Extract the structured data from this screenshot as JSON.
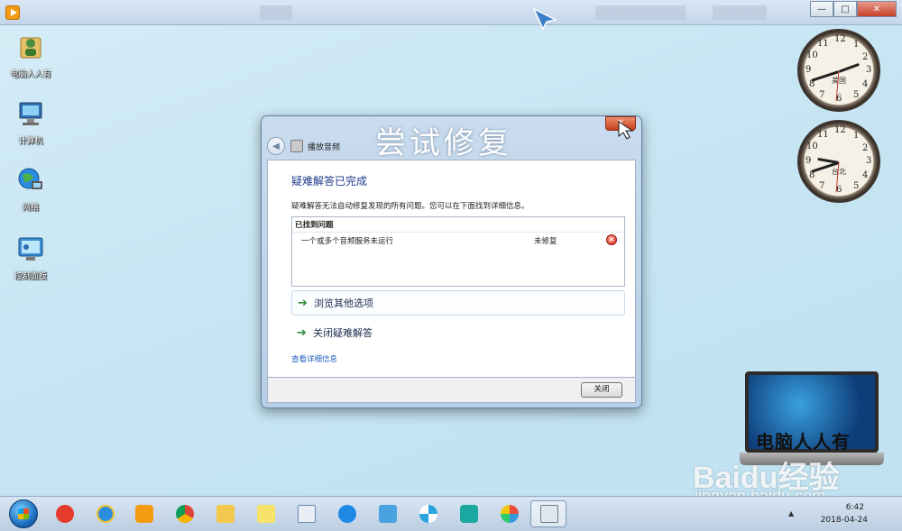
{
  "window": {
    "icon": "media-player-icon",
    "controls": {
      "minimize": "—",
      "maximize": "□",
      "close": "✕"
    }
  },
  "desktop_icons": [
    {
      "label": "电脑人人有",
      "icon": "user-folder-icon"
    },
    {
      "label": "计算机",
      "icon": "computer-icon"
    },
    {
      "label": "网络",
      "icon": "network-globe-icon"
    },
    {
      "label": "控制面板",
      "icon": "control-panel-icon"
    }
  ],
  "clocks": [
    {
      "city": "美国",
      "numbers": [
        "12",
        "1",
        "2",
        "3",
        "4",
        "5",
        "6",
        "7",
        "8",
        "9",
        "10",
        "11"
      ]
    },
    {
      "city": "台北",
      "numbers": [
        "12",
        "1",
        "2",
        "3",
        "4",
        "5",
        "6",
        "7",
        "8",
        "9",
        "10",
        "11"
      ]
    }
  ],
  "dialog": {
    "caption_overlay": "尝试修复",
    "title": "播放音频",
    "close_glyph": "✕",
    "result_title": "疑难解答已完成",
    "result_desc": "疑难解答无法自动修复发现的所有问题。您可以在下面找到详细信息。",
    "problems_header": "已找到问题",
    "problems": [
      {
        "name": "一个或多个音频服务未运行",
        "status": "未修复",
        "status_icon": "error-icon"
      }
    ],
    "options": [
      {
        "label": "浏览其他选项",
        "icon": "green-arrow-icon"
      },
      {
        "label": "关闭疑难解答",
        "icon": "green-arrow-icon"
      }
    ],
    "details_link": "查看详细信息",
    "close_button": "关闭"
  },
  "watermark": {
    "laptop_text": "电脑人人有",
    "baidu": "Baidu经验",
    "url": "jingyan.baidu.com"
  },
  "taskbar": {
    "items": [
      "start-orb-icon",
      "jiang-app-icon",
      "internet-explorer-icon",
      "media-player-icon",
      "chrome-icon",
      "file-explorer-icon",
      "notes-icon",
      "document-icon",
      "browser-icon",
      "remote-desktop-icon",
      "pinwheel-icon",
      "headset-icon",
      "paint-icon",
      "active-window-icon"
    ],
    "time": "6:42",
    "date": "2018-04-24"
  },
  "colors": {
    "desktop": "#c7e6f3",
    "accent_link": "#1f5fbf",
    "title_blue": "#1e3a8a",
    "error_red": "#d3281b",
    "arrow_green": "#2e8b3a"
  }
}
